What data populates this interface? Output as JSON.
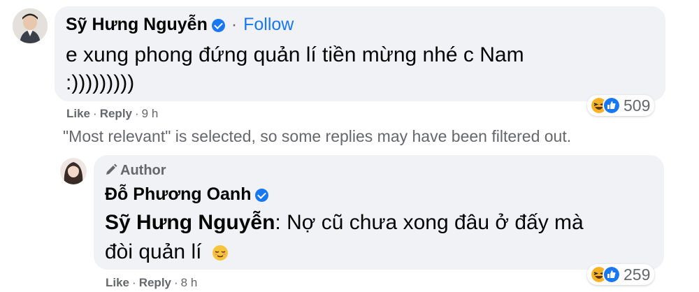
{
  "comment": {
    "author": "Sỹ Hưng Nguyễn",
    "separator": "·",
    "follow_label": "Follow",
    "text_line1": "e xung phong đứng quản lí tiền mừng nhé c Nam",
    "text_line2": ":)))))))))",
    "like_label": "Like",
    "reply_label": "Reply",
    "time": "9 h",
    "reaction_count": "509",
    "reaction_icons": [
      "haha-icon",
      "like-icon"
    ]
  },
  "filter_notice": "\"Most relevant\" is selected, so some replies may have been filtered out.",
  "reply": {
    "badge_label": "Author",
    "author": "Đỗ Phương Oanh",
    "mention": "Sỹ Hưng Nguyễn",
    "text_line1": ": Nợ cũ chưa xong đâu ở đấy mà",
    "text_line2": "đòi quản lí",
    "emoji": "relieved-face-emoji",
    "like_label": "Like",
    "reply_label": "Reply",
    "time": "8 h",
    "reaction_count": "259",
    "reaction_icons": [
      "haha-icon",
      "like-icon"
    ]
  },
  "colors": {
    "bubble": "#f0f2f5",
    "link_blue": "#1877f2",
    "secondary_text": "#65676b"
  }
}
